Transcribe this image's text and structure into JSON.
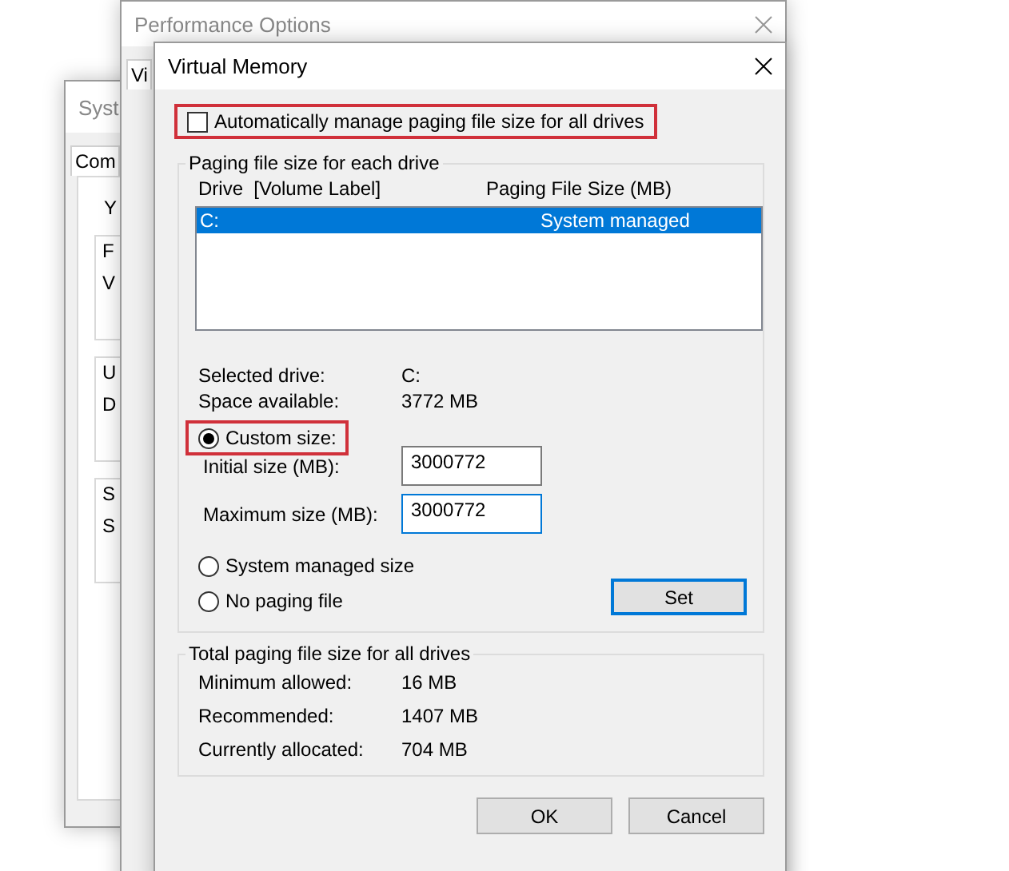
{
  "system_window": {
    "title": "Syst",
    "tab": "Com",
    "intro": "Y",
    "groups": [
      {
        "label": "F",
        "text": "V"
      },
      {
        "label": "U",
        "text": "D"
      },
      {
        "label": "S",
        "text": "S"
      }
    ]
  },
  "performance_window": {
    "title": "Performance Options",
    "tab": "Vi"
  },
  "dialog": {
    "title": "Virtual Memory",
    "auto_manage": {
      "label": "Automatically manage paging file size for all drives",
      "checked": false,
      "highlighted": true
    },
    "drives_group": {
      "title": "Paging file size for each drive",
      "columns": [
        "Drive  [Volume Label]",
        "Paging File Size (MB)"
      ],
      "rows": [
        {
          "drive": "C:",
          "size": "System managed",
          "selected": true
        }
      ],
      "info": [
        {
          "label": "Selected drive:",
          "value": "C:"
        },
        {
          "label": "Space available:",
          "value": "3772 MB"
        }
      ],
      "options": [
        {
          "label": "Custom size:",
          "selected": true,
          "highlighted": true
        },
        {
          "label": "System managed size",
          "selected": false,
          "highlighted": false
        },
        {
          "label": "No paging file",
          "selected": false,
          "highlighted": false
        }
      ],
      "fields": [
        {
          "label": "Initial size (MB):",
          "value": "3000772",
          "focused": false
        },
        {
          "label": "Maximum size (MB):",
          "value": "3000772",
          "focused": true
        }
      ],
      "set_button": "Set"
    },
    "totals_group": {
      "title": "Total paging file size for all drives",
      "rows": [
        {
          "label": "Minimum allowed:",
          "value": "16 MB"
        },
        {
          "label": "Recommended:",
          "value": "1407 MB"
        },
        {
          "label": "Currently allocated:",
          "value": "704 MB"
        }
      ]
    },
    "buttons": [
      "OK",
      "Cancel"
    ]
  }
}
